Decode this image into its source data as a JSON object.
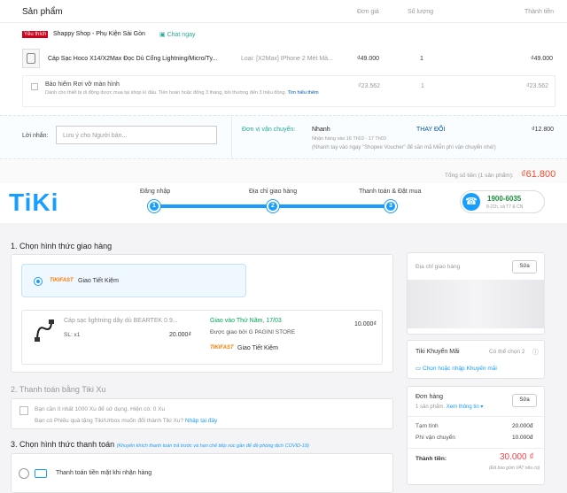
{
  "shopee": {
    "header": {
      "title": "Sản phẩm",
      "col_unit_price": "Đơn giá",
      "col_qty": "Số lượng",
      "col_total": "Thành tiền"
    },
    "shop": {
      "badge": "Yêu thích",
      "name": "Shappy Shop - Phụ Kiện Sài Gòn",
      "chat": "Chat ngay"
    },
    "product": {
      "name": "Cáp Sạc Hoco X14/X2Max Đọc Dù Cổng Lightning/Micro/Ty...",
      "variant": "Loại: [X2Max] IPhone 2 Mét Mà...",
      "price": "₫49.000",
      "qty": "1",
      "total": "₫49.000"
    },
    "insurance": {
      "title": "Bảo hiểm Rơi vỡ màn hình",
      "desc": "Dành cho thiết bị di động được mua tại shop kì đấu. Tiền hoàn hoặc đổng 3 tháng, bồi thường đến 3 triệu đồng.",
      "link": "Tìm hiểu thêm",
      "price": "₫23.562",
      "qty": "1",
      "total": "₫23.562"
    },
    "message": {
      "label": "Lời nhắn:",
      "placeholder": "Lưu ý cho Người bán..."
    },
    "shipping": {
      "label": "Đơn vị vận chuyển:",
      "method": "Nhanh",
      "change": "THAY ĐỔI",
      "fee": "₫12.800",
      "eta": "Nhận hàng vào 16 Th03 - 17 Th03",
      "note": "(Nhanh tay vào ngay \"Shopee Voucher\" để săn mã Miễn phí vận chuyển nhé!)"
    },
    "summary": {
      "label": "Tổng số tiền (1 sản phẩm):",
      "value": "₫61.800"
    }
  },
  "tiki": {
    "logo": "TiKi",
    "steps": [
      {
        "label": "Đăng nhập",
        "num": "1"
      },
      {
        "label": "Địa chỉ giao hàng",
        "num": "2"
      },
      {
        "label": "Thanh toán & Đặt mua",
        "num": "3"
      }
    ],
    "hotline": {
      "number": "1900-6035",
      "hours": "8-21h, cả T7 & CN"
    },
    "section1": {
      "title": "1. Chọn hình thức giao hàng",
      "option_brand": "TIKIFAST",
      "option_label": "Giao Tiết Kiệm",
      "item_name": "Cáp sạc lightning dây dù BEARTEK 0.9...",
      "item_qty": "SL: x1",
      "item_price": "20.000₫",
      "delivery_date": "Giao vào Thứ Năm, 17/03",
      "delivery_by": "Được giao bởi G PAGINI STORE",
      "delivery_fee": "10.000₫",
      "delivery_brand": "TIKIFAST",
      "delivery_method": "Giao Tiết Kiệm"
    },
    "section2": {
      "title": "2. Thanh toán bằng Tiki Xu",
      "line1": "Bạn cần ít nhất 1000 Xu để sử dụng. Hiện có: 0 Xu",
      "line2": "Bạn có Phiếu quà tặng Tiki/Urbox muốn đổi thành Tiki Xu?",
      "link": "Nhập tại đây"
    },
    "section3": {
      "title": "3. Chọn hình thức thanh toán",
      "note": "(Khuyến khích thanh toán trả trước và hạn chế tiếp xúc gần để đề phòng dịch COVID-19)",
      "option": "Thanh toán tiền mặt khi nhận hàng"
    },
    "address": {
      "label": "Địa chỉ giao hàng",
      "edit": "Sửa"
    },
    "promo": {
      "title": "Tiki Khuyến Mãi",
      "count": "Có thể chọn 2",
      "link": "Chọn hoặc nhập Khuyến mãi"
    },
    "order": {
      "title": "Đơn hàng",
      "count": "1 sản phẩm.",
      "view": "Xem thông tin",
      "edit": "Sửa",
      "subtotal_label": "Tạm tính",
      "subtotal": "20.000đ",
      "ship_label": "Phí vận chuyển",
      "ship": "10.000đ",
      "total_label": "Thành tiền:",
      "total": "30.000 ₫",
      "vat": "(Đã bao gồm VAT nếu có)"
    }
  },
  "colors": {
    "shopee_orange": "#ee4d2d",
    "tiki_blue": "#189eff",
    "tiki_red": "#ff424e"
  }
}
